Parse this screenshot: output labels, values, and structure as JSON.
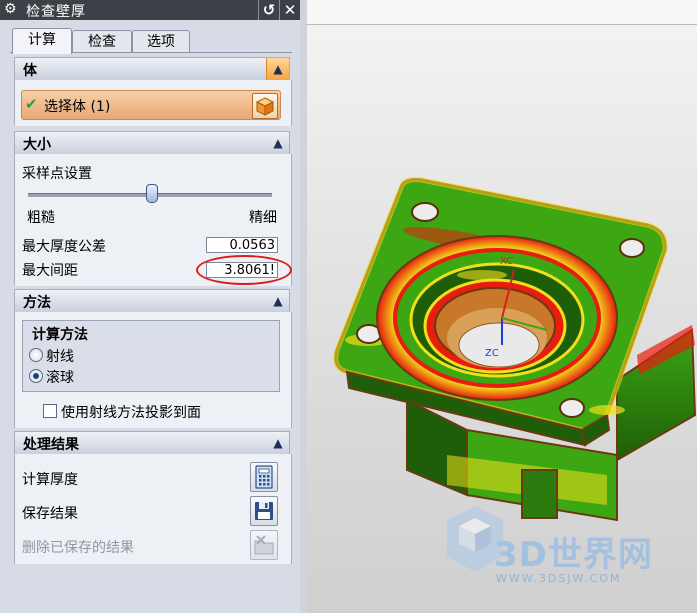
{
  "dialog": {
    "title": "检查壁厚",
    "close_glyph": "✕",
    "reset_glyph": "↺",
    "tabs": [
      {
        "label": "计算",
        "active": true
      },
      {
        "label": "检查",
        "active": false
      },
      {
        "label": "选项",
        "active": false
      }
    ]
  },
  "body_section": {
    "header": "体",
    "select_label": "选择体 (1)"
  },
  "size_section": {
    "header": "大小",
    "sample_label": "采样点设置",
    "slider_min_label": "粗糙",
    "slider_max_label": "精细",
    "slider_level": 0.5,
    "max_thickness_tol_label": "最大厚度公差",
    "max_thickness_tol_value": "0.0563",
    "max_spacing_label": "最大间距",
    "max_spacing_value": "3.8061!"
  },
  "method_section": {
    "header": "方法",
    "group_title": "计算方法",
    "options": [
      {
        "label": "射线",
        "selected": false
      },
      {
        "label": "滚球",
        "selected": true
      }
    ],
    "projection_checkbox_label": "使用射线方法投影到面",
    "projection_checked": false
  },
  "results_section": {
    "header": "处理结果",
    "compute_label": "计算厚度",
    "save_label": "保存结果",
    "delete_label": "删除已保存的结果"
  },
  "viewport": {
    "axis_x_label": "XC",
    "axis_z_label": "ZC",
    "watermark_text": "3D世界网",
    "watermark_url": "WWW.3DSJW.COM"
  },
  "colors": {
    "accent_orange": "#f5a640",
    "model_green": "#3ca613",
    "hot_red": "#e81d0f",
    "check_green": "#2f9e2f",
    "annotation_red": "#d81f1f"
  }
}
